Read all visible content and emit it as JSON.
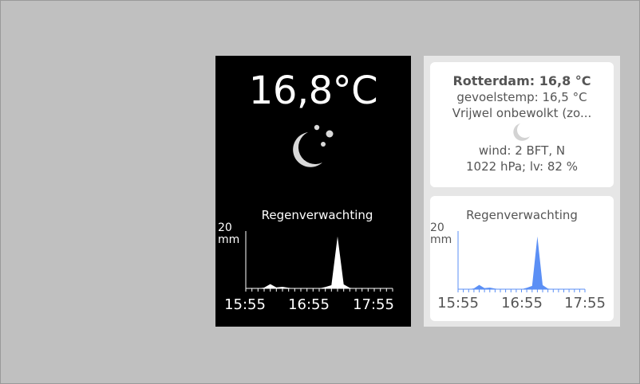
{
  "dark_widget": {
    "temperature": "16,8°C",
    "condition_icon": "moon-icon",
    "rain_title": "Regenverwachting",
    "axis_max": "20",
    "axis_unit": "mm",
    "times": [
      "15:55",
      "16:55",
      "17:55"
    ]
  },
  "info_card": {
    "title": "Rotterdam: 16,8 °C",
    "feels_like": "gevoelstemp: 16,5 °C",
    "condition": "Vrijwel onbewolkt (zo...",
    "condition_icon": "moon-icon",
    "wind": "wind: 2 BFT, N",
    "pressure_humidity": "1022 hPa; lv: 82 %"
  },
  "rain_card": {
    "title": "Regenverwachting",
    "axis_max": "20",
    "axis_unit": "mm",
    "times": [
      "15:55",
      "16:55",
      "17:55"
    ],
    "color": "#5b8ff5"
  },
  "chart_data": {
    "type": "area",
    "title": "Regenverwachting",
    "ylabel": "mm",
    "ylim": [
      0,
      20
    ],
    "x": [
      "15:55",
      "16:00",
      "16:05",
      "16:10",
      "16:15",
      "16:20",
      "16:25",
      "16:30",
      "16:35",
      "16:40",
      "16:45",
      "16:50",
      "16:55",
      "17:00",
      "17:05",
      "17:10",
      "17:15",
      "17:20",
      "17:25",
      "17:30",
      "17:35",
      "17:40",
      "17:45",
      "17:50",
      "17:55"
    ],
    "values": [
      0,
      0,
      0,
      0.3,
      1.6,
      0.4,
      0.6,
      0.2,
      0,
      0,
      0,
      0,
      0,
      0.5,
      1.2,
      19.5,
      1.5,
      0.2,
      0,
      0,
      0,
      0,
      0,
      0,
      0
    ]
  }
}
